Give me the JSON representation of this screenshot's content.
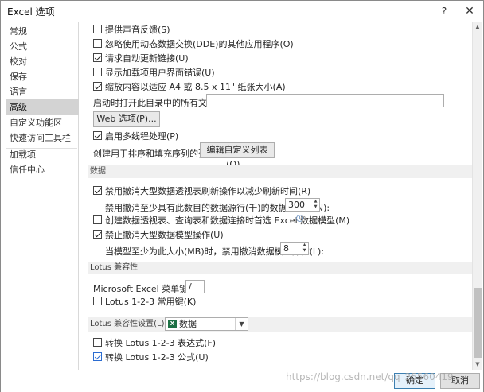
{
  "window": {
    "title": "Excel 选项",
    "help_label": "?",
    "close_label": "✕"
  },
  "sidebar": {
    "items": [
      {
        "label": "常规"
      },
      {
        "label": "公式"
      },
      {
        "label": "校对"
      },
      {
        "label": "保存"
      },
      {
        "label": "语言"
      },
      {
        "label": "高级",
        "active": true
      },
      {
        "label": "自定义功能区"
      },
      {
        "label": "快速访问工具栏"
      },
      {
        "label": "加载项"
      },
      {
        "label": "信任中心"
      }
    ]
  },
  "general": {
    "opt1": {
      "label": "提供声音反馈(S)",
      "checked": false
    },
    "opt2": {
      "label": "忽略使用动态数据交换(DDE)的其他应用程序(O)",
      "checked": false
    },
    "opt3": {
      "label": "请求自动更新链接(U)",
      "checked": true
    },
    "opt4": {
      "label": "显示加载项用户界面错误(U)",
      "checked": false
    },
    "opt5": {
      "label": "缩放内容以适应 A4 或 8.5 x 11\" 纸张大小(A)",
      "checked": true
    },
    "startup_label": "启动时打开此目录中的所有文件(L):",
    "startup_value": "",
    "web_options_button": "Web 选项(P)...",
    "multithread": {
      "label": "启用多线程处理(P)",
      "checked": true
    },
    "custom_list_label": "创建用于排序和填充序列的列表:",
    "custom_list_button": "编辑自定义列表(O)..."
  },
  "data_section": {
    "header": "数据",
    "opt1": {
      "label": "禁用撤消大型数据透视表刷新操作以减少刷新时间(R)",
      "checked": true
    },
    "rows_label": "禁用撤消至少具有此数目的数据源行(千)的数据透视表(N):",
    "rows_value": "300",
    "opt2": {
      "label": "创建数据透视表、查询表和数据连接时首选 Excel 数据模型(M)",
      "checked": false
    },
    "opt2_info": "i",
    "opt3": {
      "label": "禁止撤消大型数据模型操作(U)",
      "checked": true
    },
    "model_label": "当模型至少为此大小(MB)时，禁用撤消数据模型操作(L):",
    "model_value": "8"
  },
  "lotus_section": {
    "header": "Lotus 兼容性",
    "menu_key_label": "Microsoft Excel 菜单键(M):",
    "menu_key_value": "/",
    "nav_keys": {
      "label": "Lotus 1-2-3 常用键(K)",
      "checked": false
    }
  },
  "lotus_settings": {
    "header": "Lotus 兼容性设置(L):",
    "sheet_value": "数据",
    "sheet_icon": "excel-sheet-icon",
    "formula_eval": {
      "label": "转换 Lotus 1-2-3 表达式(F)",
      "checked": false
    },
    "formula_entry": {
      "label": "转换 Lotus 1-2-3 公式(U)",
      "checked": true
    }
  },
  "footer": {
    "ok_label": "确定",
    "cancel_label": "取消",
    "watermark": "https://blog.csdn.net/qq_25560419"
  }
}
